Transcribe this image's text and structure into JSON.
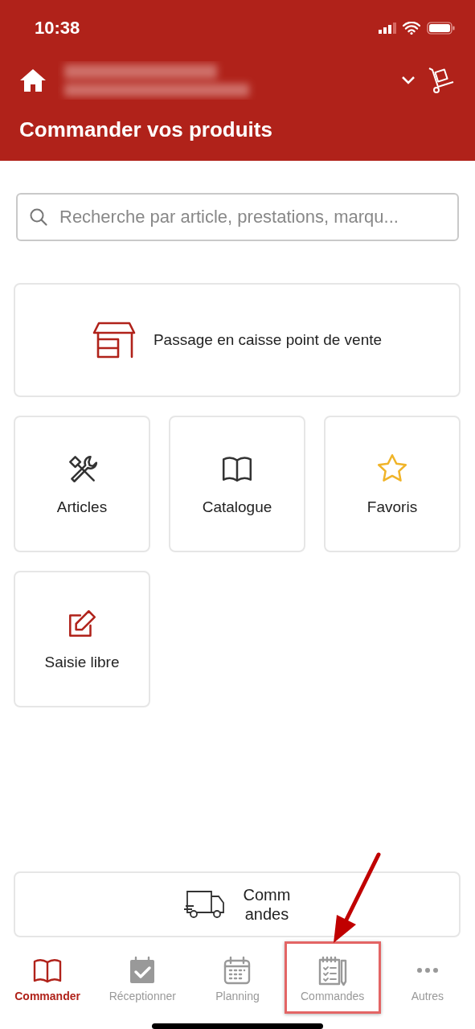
{
  "status_bar": {
    "time": "10:38"
  },
  "header": {
    "title": "Commander vos produits"
  },
  "search": {
    "placeholder": "Recherche par article, prestations, marqu..."
  },
  "checkout_card": {
    "label": "Passage en caisse point de vente"
  },
  "tiles": [
    {
      "label": "Articles",
      "kind": "tools"
    },
    {
      "label": "Catalogue",
      "kind": "book"
    },
    {
      "label": "Favoris",
      "kind": "star"
    },
    {
      "label": "Saisie libre",
      "kind": "edit"
    }
  ],
  "orders_button": {
    "label": "Commandes"
  },
  "tabs": [
    {
      "label": "Commander",
      "kind": "book",
      "selected": true,
      "highlighted": false
    },
    {
      "label": "Réceptionner",
      "kind": "check",
      "selected": false,
      "highlighted": false
    },
    {
      "label": "Planning",
      "kind": "calendar",
      "selected": false,
      "highlighted": false
    },
    {
      "label": "Commandes",
      "kind": "list",
      "selected": false,
      "highlighted": true
    },
    {
      "label": "Autres",
      "kind": "dots",
      "selected": false,
      "highlighted": false
    }
  ]
}
